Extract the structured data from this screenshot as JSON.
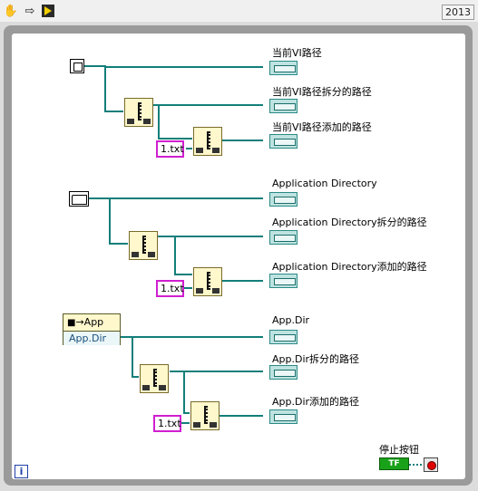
{
  "toolbar": {
    "version": "2013",
    "icons": [
      "hand-icon",
      "arrow-icon",
      "run-icon"
    ]
  },
  "diagram": {
    "section1": {
      "output_label": "当前VI路径",
      "split_label": "当前VI路径拆分的路径",
      "append_label": "当前VI路径添加的路径",
      "constant": "1.txt"
    },
    "section2": {
      "output_label": "Application Directory",
      "split_label": "Application Directory拆分的路径",
      "append_label": "Application Directory添加的路径",
      "constant": "1.txt"
    },
    "section3": {
      "node_class": "App",
      "node_property": "App.Dir",
      "output_label": "App.Dir",
      "split_label": "App.Dir拆分的路径",
      "append_label": "App.Dir添加的路径",
      "constant": "1.txt"
    },
    "stop": {
      "label": "停止按钮",
      "tf": "TF"
    },
    "info_icon": "i"
  },
  "colors": {
    "wire": "#127f7a",
    "string_constant_border": "#d01fd0",
    "loop_border": "#9a9a9a"
  }
}
